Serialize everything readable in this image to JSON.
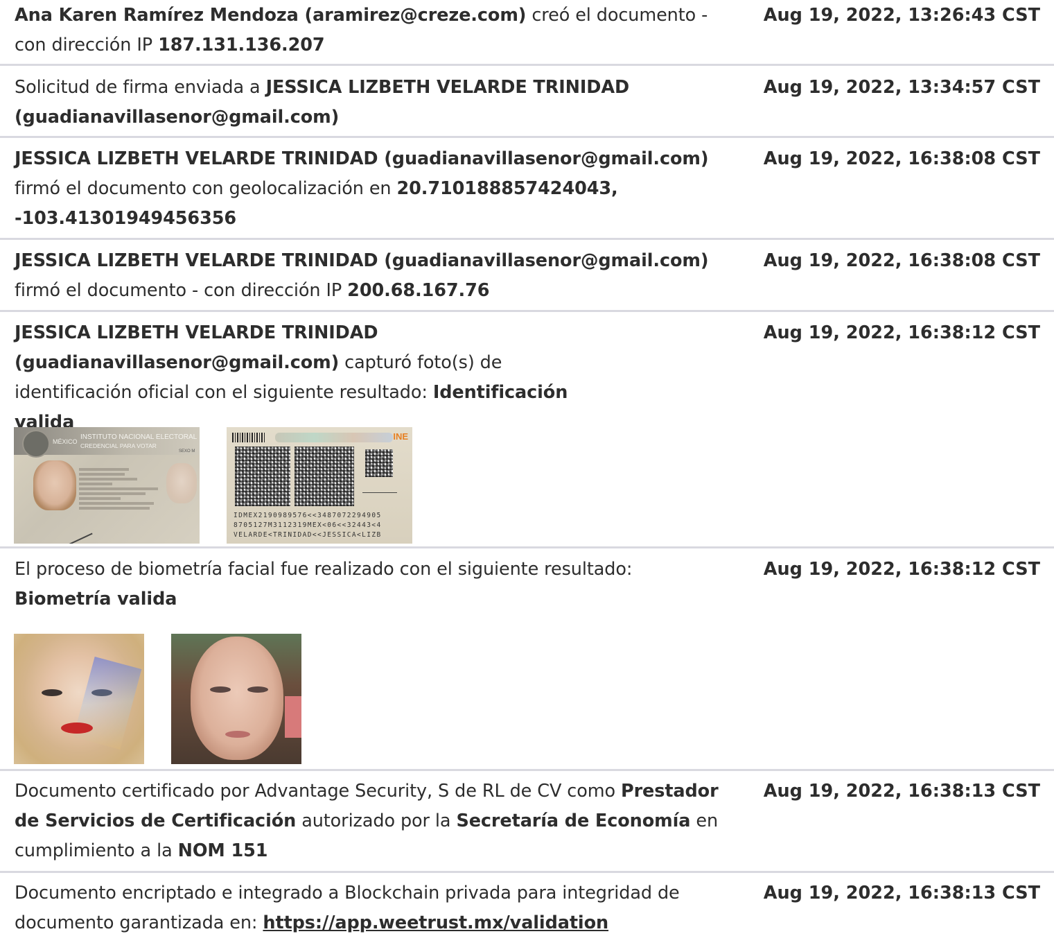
{
  "entries": [
    {
      "time": "Aug 19, 2022, 13:26:43 CST",
      "actor": "Ana Karen Ramírez Mendoza (aramirez@creze.com)",
      "text_a": " creó el documento - con dirección IP ",
      "ip": "187.131.136.207"
    },
    {
      "time": "Aug 19, 2022, 13:34:57 CST",
      "text_a": "Solicitud de firma enviada a ",
      "recipient": "JESSICA LIZBETH VELARDE TRINIDAD (guadianavillasenor@gmail.com)"
    },
    {
      "time": "Aug 19, 2022, 16:38:08 CST",
      "actor": "JESSICA LIZBETH VELARDE TRINIDAD (guadianavillasenor@gmail.com)",
      "text_a": " firmó el documento con geolocalización en ",
      "geo": "20.710188857424043, -103.41301949456356"
    },
    {
      "time": "Aug 19, 2022, 16:38:08 CST",
      "actor": "JESSICA LIZBETH VELARDE TRINIDAD (guadianavillasenor@gmail.com)",
      "text_a": " firmó el documento - con dirección IP ",
      "ip": "200.68.167.76"
    },
    {
      "time": "Aug 19, 2022, 16:38:12 CST",
      "actor": "JESSICA LIZBETH VELARDE TRINIDAD (guadianavillasenor@gmail.com)",
      "text_a": " capturó foto(s) de identificación oficial con el siguiente resultado: ",
      "result": "Identificación valida",
      "id_front": {
        "country": "MÉXICO",
        "line1": "INSTITUTO NACIONAL ELECTORAL",
        "line2": "CREDENCIAL PARA VOTAR",
        "sexo": "SEXO M"
      },
      "id_back": {
        "brand": "INE",
        "mrz1": "IDMEX2190989576<<3487072294905",
        "mrz2": "8705127M3112319MEX<06<<32443<4",
        "mrz3": "VELARDE<TRINIDAD<<JESSICA<LIZB"
      }
    },
    {
      "time": "Aug 19, 2022, 16:38:12 CST",
      "text_a": "El proceso de biometría facial fue realizado con el siguiente resultado: ",
      "result": "Biometría valida"
    },
    {
      "time": "Aug 19, 2022, 16:38:13 CST",
      "text_a": "Documento certificado por Advantage Security, S de RL de CV como ",
      "b1": "Prestador de Servicios de Certificación",
      "text_b": " autorizado por la ",
      "b2": "Secretaría de Economía",
      "text_c": " en cumplimiento a la ",
      "b3": "NOM 151"
    },
    {
      "time": "Aug 19, 2022, 16:38:13 CST",
      "text_a": "Documento encriptado e integrado a Blockchain privada para integridad de documento garantizada en: ",
      "link": "https://app.weetrust.mx/validation"
    }
  ]
}
